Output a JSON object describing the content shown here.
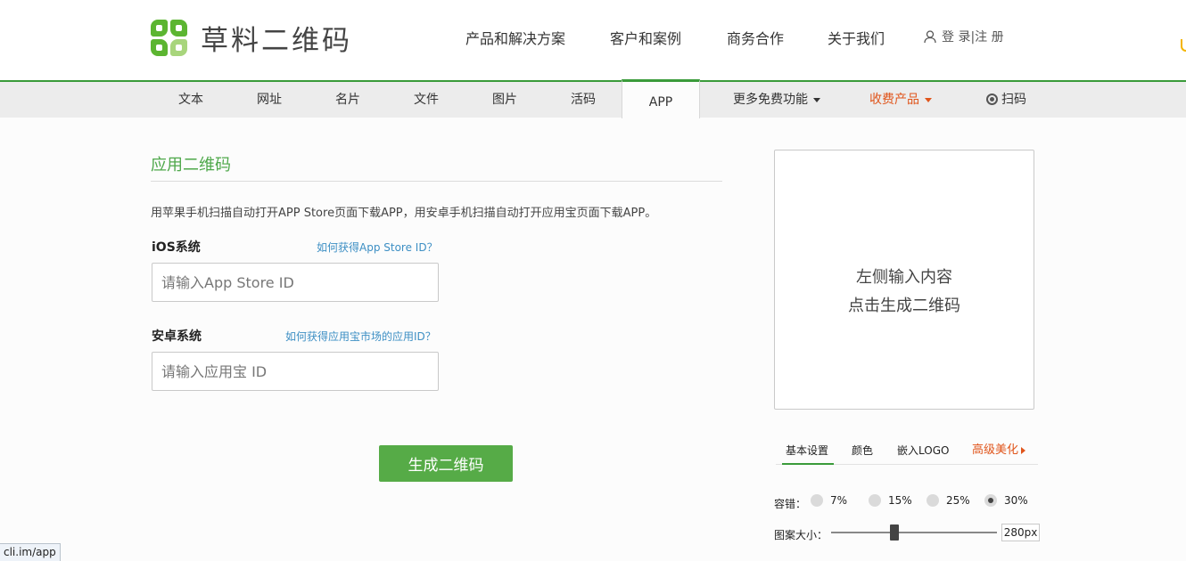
{
  "brand": {
    "name": "草料二维码"
  },
  "top_nav": [
    "产品和解决方案",
    "客户和案例",
    "商务合作",
    "关于我们"
  ],
  "auth": {
    "login_register": "登 录|注 册"
  },
  "sub_nav": {
    "items": [
      "文本",
      "网址",
      "名片",
      "文件",
      "图片",
      "活码",
      "APP"
    ],
    "active": "APP",
    "more_free": "更多免费功能",
    "paid": "收费产品",
    "scan": "扫码"
  },
  "form": {
    "title": "应用二维码",
    "description": "用苹果手机扫描自动打开APP Store页面下载APP，用安卓手机扫描自动打开应用宝页面下载APP。",
    "ios": {
      "label": "iOS系统",
      "help": "如何获得App Store ID？",
      "placeholder": "请输入App Store ID",
      "value": ""
    },
    "android": {
      "label": "安卓系统",
      "help": "如何获得应用宝市场的应用ID？",
      "placeholder": "请输入应用宝 ID",
      "value": ""
    },
    "generate_button": "生成二维码"
  },
  "preview": {
    "line1": "左侧输入内容",
    "line2": "点击生成二维码"
  },
  "settings": {
    "tabs": [
      "基本设置",
      "颜色",
      "嵌入LOGO",
      "高级美化"
    ],
    "active_tab": "基本设置",
    "error_correction_label": "容错：",
    "error_levels": [
      "7%",
      "15%",
      "25%",
      "30%"
    ],
    "selected_level": "30%",
    "size_label": "图案大小：",
    "size_value": "280px",
    "size_slider_fraction": 0.38
  },
  "status_bar": {
    "url": "cli.im/app"
  },
  "colors": {
    "accent_green": "#56ab47",
    "accent_orange": "#e0551b",
    "link_blue": "#3d8fc4"
  }
}
